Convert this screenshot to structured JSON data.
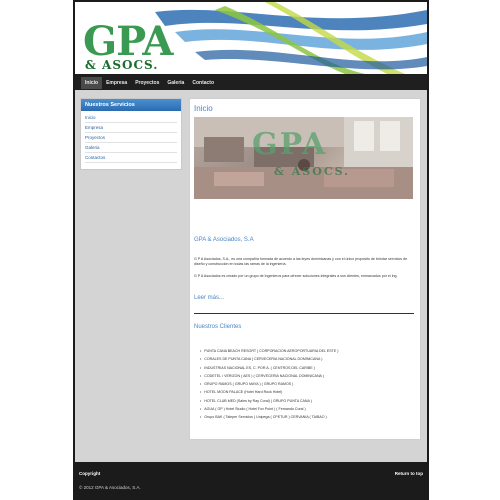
{
  "header": {
    "logo_main": "GPA",
    "logo_sub": "& ASOCS."
  },
  "nav": {
    "items": [
      "Inicio",
      "Empresa",
      "Proyectos",
      "Galeria",
      "Contacto"
    ]
  },
  "sidebar": {
    "title": "Nuestros Servicios",
    "items": [
      "Inicio",
      "Empresa",
      "Proyectos",
      "Galeria",
      "Contactos"
    ]
  },
  "main": {
    "page_title": "Inicio",
    "hero_logo_main": "GPA",
    "hero_logo_sub": "& ASOCS.",
    "company_title": "GPA & Asociados, S.A",
    "paragraph_1": "G P A Asociados, S.A., es una compañía formada de acuerdo a las leyes dominicanas y con el único propósito de brindar servicios de diseño y construcción en todas las ramas de la ingeniería.",
    "paragraph_2": "G P A Asociados es creado por un grupo de ingenieros para ofrecer soluciones integrales a sus clientes, enmarcados por el ing.",
    "read_more": "Leer más...",
    "clients_title": "Nuestros Clientes",
    "clients": [
      "PUNTA CANA BEACH RESORT ( CORPORACION AEROPORTUARIA DEL ESTE )",
      "CORALES DE PUNTA CANA ( CERVECERIA NACIONAL DOMINICANA )",
      "INDUSTRIAS NACIONAL ES, C. POR A. ( CENTROS DEL CARIBE )",
      "CODETEL / VERIZON ( AES ) ( CERVECERIA NACIONAL DOMINICANA )",
      "GRUPO RAMOS ( GRUPO MAYA ) ( GRUPO RAMOS )",
      "HOTEL MOON PALACE (Hotel Hard Rock Hotel)",
      "HOTEL CLUB MED (Sales by Ray Coral) ( GRUPO PUNTA CANA )",
      "AGUA ( GP ) Hotel Studio ( Hotel Fox Point ) ( Fernando Coral )",
      "Grupo BAK ( Taleper Servicios ( Unipega ( CPETUR ) CERVANIA ( TAIBAO )"
    ]
  },
  "footer": {
    "left_label": "Copyright",
    "copyright": "© 2012 GPA & Asociados, S.A.",
    "return_link": "Return to top"
  },
  "colors": {
    "accent_blue": "#4b86c5",
    "logo_green": "#3a9a52",
    "nav_bg": "#1f1f1f"
  }
}
